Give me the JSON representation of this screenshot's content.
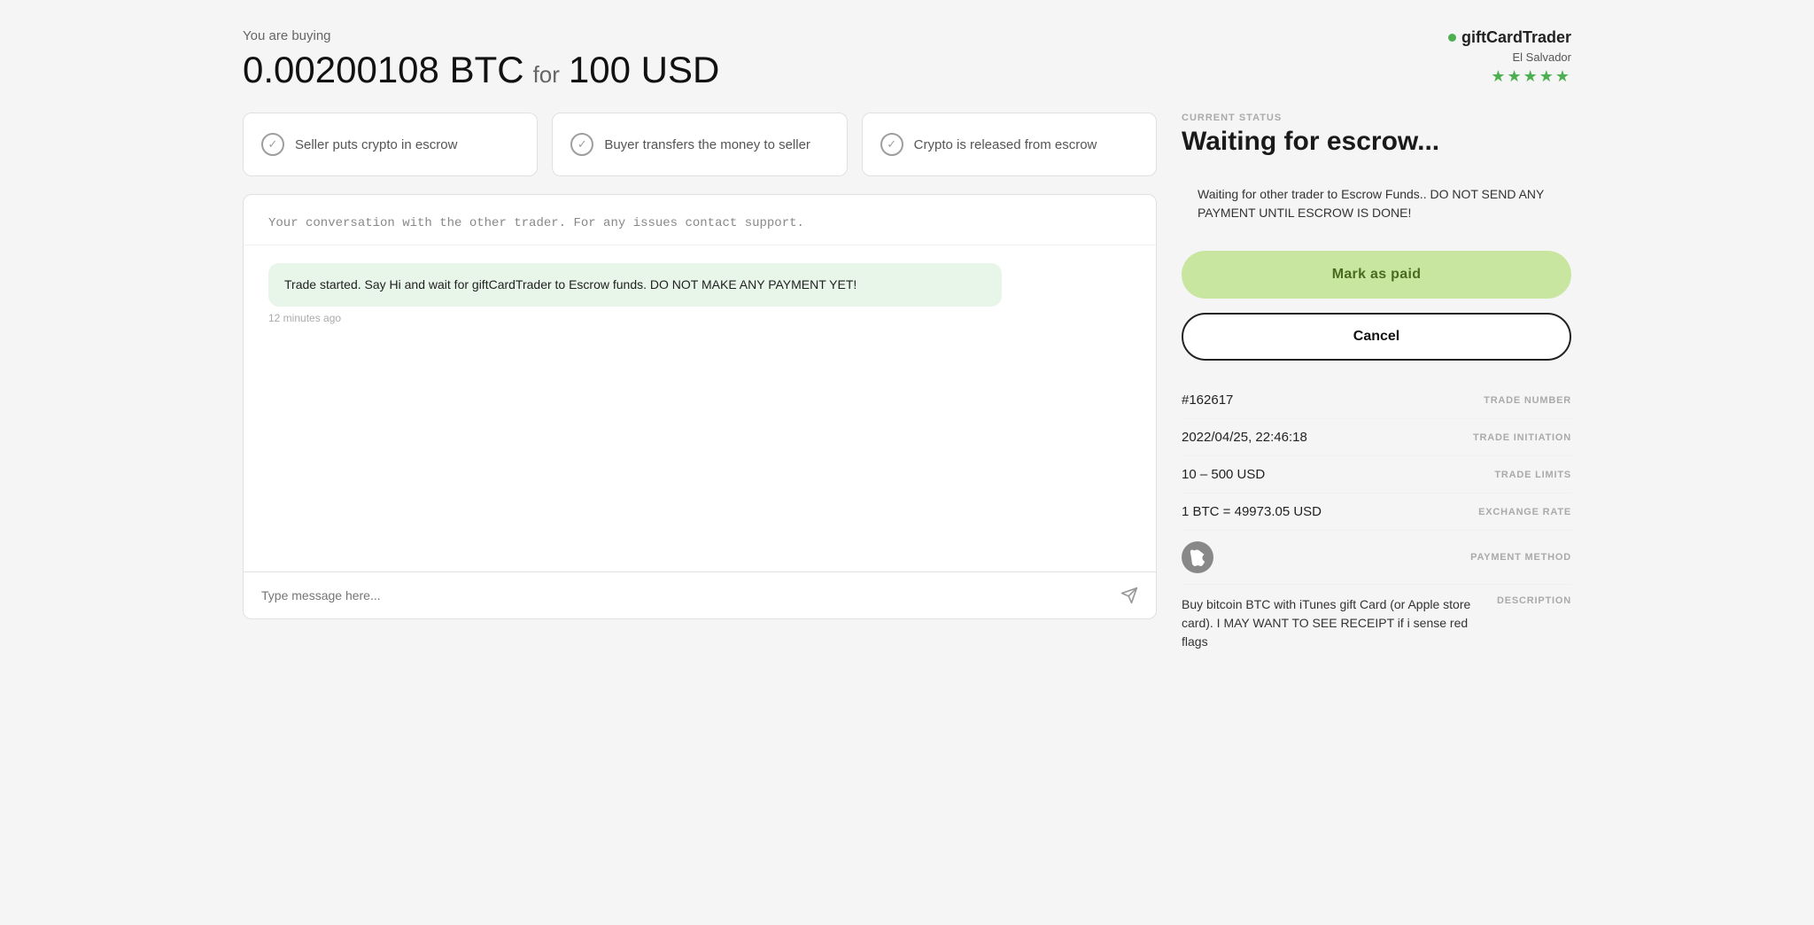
{
  "header": {
    "buy_label": "You are buying",
    "btc_amount": "0.00200108 BTC",
    "for_word": "for",
    "usd_amount": "100 USD"
  },
  "trader": {
    "name": "giftCardTrader",
    "location": "El Salvador",
    "stars": "★★★★★",
    "online": true
  },
  "steps": [
    {
      "label": "Seller puts crypto in escrow",
      "icon": "✓"
    },
    {
      "label": "Buyer transfers the money to seller",
      "icon": "✓"
    },
    {
      "label": "Crypto is released from escrow",
      "icon": "✓"
    }
  ],
  "chat": {
    "header_note": "Your conversation with the other trader. For any issues contact support.",
    "message": "Trade started. Say Hi and wait for giftCardTrader to Escrow funds. DO NOT MAKE ANY PAYMENT YET!",
    "timestamp": "12 minutes ago",
    "input_placeholder": "Type message here...",
    "send_icon": "➤"
  },
  "status": {
    "label": "CURRENT STATUS",
    "title": "Waiting for escrow...",
    "warning": "Waiting for other trader to Escrow Funds.. DO NOT SEND ANY PAYMENT UNTIL ESCROW IS DONE!",
    "mark_paid_label": "Mark as paid",
    "cancel_label": "Cancel"
  },
  "trade_details": {
    "trade_number_value": "#162617",
    "trade_number_label": "TRADE NUMBER",
    "trade_initiation_value": "2022/04/25, 22:46:18",
    "trade_initiation_label": "TRADE INITIATION",
    "trade_limits_value": "10 – 500 USD",
    "trade_limits_label": "TRADE LIMITS",
    "exchange_rate_value": "1 BTC = 49973.05 USD",
    "exchange_rate_label": "EXCHANGE RATE",
    "payment_method_label": "PAYMENT METHOD",
    "payment_icon": "",
    "description_text": "Buy bitcoin BTC with iTunes gift Card (or Apple store card). I MAY WANT TO SEE RECEIPT if i sense red flags",
    "description_label": "DESCRIPTION"
  }
}
